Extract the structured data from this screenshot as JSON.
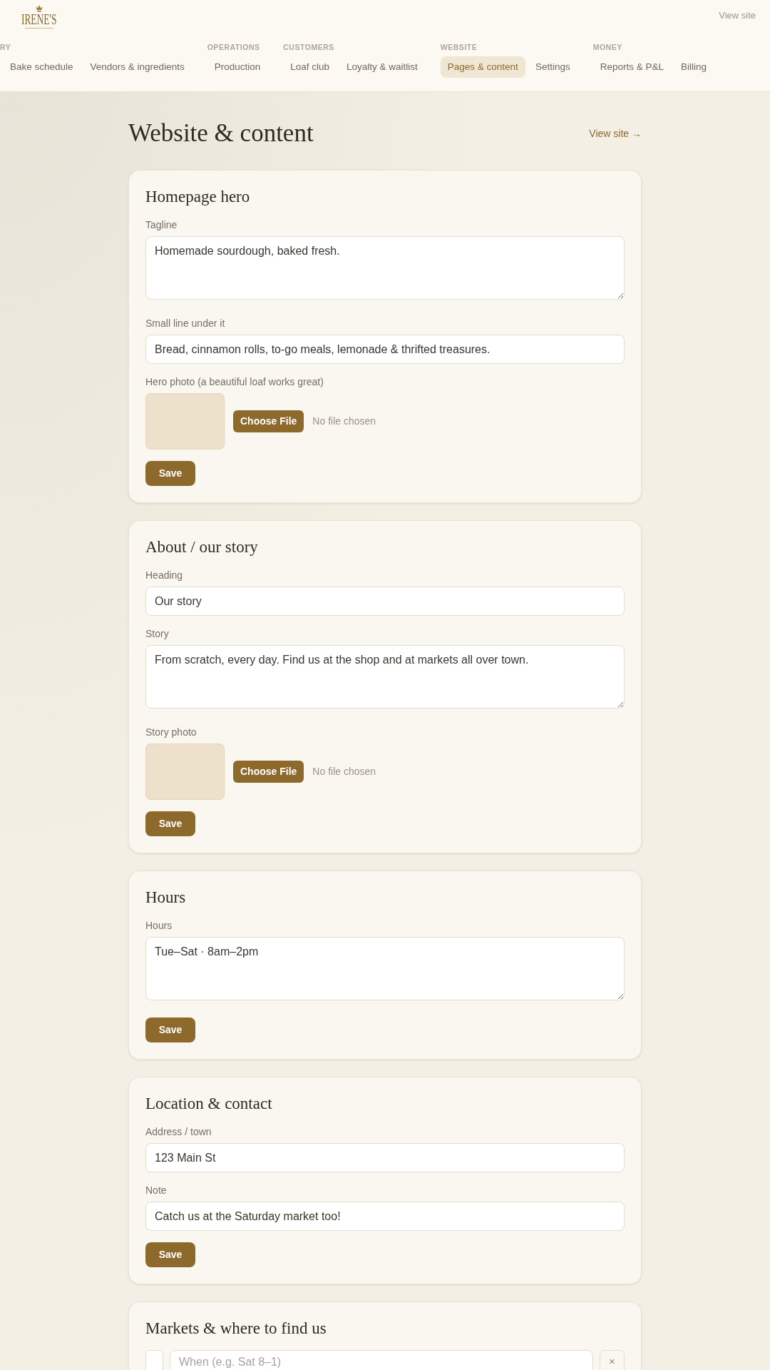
{
  "brand": {
    "name": "IRENE'S"
  },
  "header_link": "View site",
  "nav": [
    {
      "label": "RY",
      "items": [
        {
          "label": "Bake schedule",
          "selected": false
        },
        {
          "label": "Vendors & ingredients",
          "selected": false
        }
      ]
    },
    {
      "label": "OPERATIONS",
      "items": [
        {
          "label": "Production",
          "selected": false
        }
      ]
    },
    {
      "label": "CUSTOMERS",
      "items": [
        {
          "label": "Loaf club",
          "selected": false
        },
        {
          "label": "Loyalty & waitlist",
          "selected": false
        }
      ]
    },
    {
      "label": "WEBSITE",
      "items": [
        {
          "label": "Pages & content",
          "selected": true
        },
        {
          "label": "Settings",
          "selected": false
        }
      ]
    },
    {
      "label": "MONEY",
      "items": [
        {
          "label": "Reports & P&L",
          "selected": false
        },
        {
          "label": "Billing",
          "selected": false
        }
      ]
    }
  ],
  "page": {
    "title": "Website & content",
    "link": "View site →"
  },
  "sections": [
    {
      "title": "Homepage hero",
      "fields": [
        {
          "kind": "textarea",
          "label": "Tagline",
          "value": "Homemade sourdough, baked fresh."
        },
        {
          "kind": "input",
          "label": "Small line under it",
          "value": "Bread, cinnamon rolls, to-go meals, lemonade & thrifted treasures."
        },
        {
          "kind": "photo",
          "label": "Hero photo (a beautiful loaf works great)",
          "button": "Choose File",
          "status": "No file chosen"
        }
      ],
      "save": "Save"
    },
    {
      "title": "About / our story",
      "fields": [
        {
          "kind": "input",
          "label": "Heading",
          "value": "Our story"
        },
        {
          "kind": "textarea",
          "label": "Story",
          "value": "From scratch, every day. Find us at the shop and at markets all over town."
        },
        {
          "kind": "photo",
          "label": "Story photo",
          "button": "Choose File",
          "status": "No file chosen"
        }
      ],
      "save": "Save"
    },
    {
      "title": "Hours",
      "fields": [
        {
          "kind": "textarea",
          "label": "Hours",
          "value": "Tue–Sat · 8am–2pm"
        }
      ],
      "save": "Save"
    },
    {
      "title": "Location & contact",
      "fields": [
        {
          "kind": "input",
          "label": "Address / town",
          "value": "123 Main St"
        },
        {
          "kind": "input",
          "label": "Note",
          "value": "Catch us at the Saturday market too!"
        }
      ],
      "save": "Save"
    },
    {
      "title": "Markets & where to find us",
      "fields": [
        {
          "kind": "market_row",
          "placeholder": "When (e.g. Sat 8–1)",
          "remove": "×"
        }
      ]
    }
  ]
}
